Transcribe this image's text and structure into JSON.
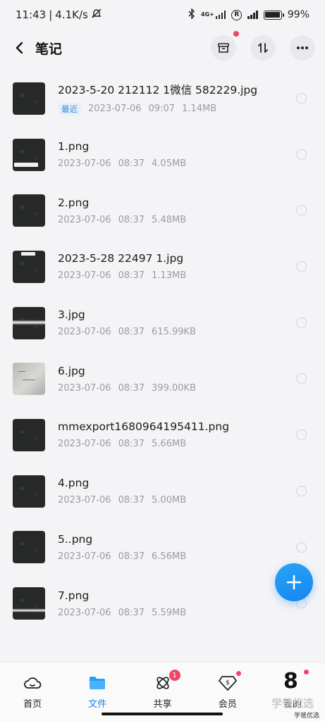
{
  "status_bar": {
    "time": "11:43",
    "speed": "4.1K/s",
    "network": "4G+",
    "battery": "99"
  },
  "header": {
    "title": "笔记"
  },
  "files": [
    {
      "name": "2023-5-20 212112 1微信 582229.jpg",
      "tag": "最近",
      "date": "2023-07-06",
      "time": "09:07",
      "size": "1.14MB",
      "thumb": "dark"
    },
    {
      "name": "1.png",
      "date": "2023-07-06",
      "time": "08:37",
      "size": "4.05MB",
      "thumb": "dark-bar-bottom"
    },
    {
      "name": "2.png",
      "date": "2023-07-06",
      "time": "08:37",
      "size": "5.48MB",
      "thumb": "dark"
    },
    {
      "name": "2023-5-28 22497 1.jpg",
      "date": "2023-07-06",
      "time": "08:37",
      "size": "1.13MB",
      "thumb": "dark-bar-top"
    },
    {
      "name": "3.jpg",
      "date": "2023-07-06",
      "time": "08:37",
      "size": "615.99KB",
      "thumb": "dark-band"
    },
    {
      "name": "6.jpg",
      "date": "2023-07-06",
      "time": "08:37",
      "size": "399.00KB",
      "thumb": "light"
    },
    {
      "name": "mmexport1680964195411.png",
      "date": "2023-07-06",
      "time": "08:37",
      "size": "5.66MB",
      "thumb": "dark"
    },
    {
      "name": "4.png",
      "date": "2023-07-06",
      "time": "08:37",
      "size": "5.00MB",
      "thumb": "dark"
    },
    {
      "name": "5..png",
      "date": "2023-07-06",
      "time": "08:37",
      "size": "6.56MB",
      "thumb": "dark"
    },
    {
      "name": "7.png",
      "date": "2023-07-06",
      "time": "08:37",
      "size": "5.59MB",
      "thumb": "dark-band-low"
    }
  ],
  "bottom_nav": {
    "items": [
      {
        "label": "首页",
        "icon": "cloud-icon"
      },
      {
        "label": "文件",
        "icon": "folder-icon"
      },
      {
        "label": "共享",
        "icon": "atom-icon",
        "badge": "1"
      },
      {
        "label": "会员",
        "icon": "vip-diamond-icon"
      },
      {
        "label": "我的",
        "icon": "profile-icon"
      }
    ]
  },
  "overlay": {
    "number": "8",
    "watermark": "学爸优选",
    "watermark_small": "学爸优选"
  },
  "colors": {
    "accent": "#1486ee",
    "badge": "#f0456a",
    "tag_bg": "#e5f0fb"
  }
}
